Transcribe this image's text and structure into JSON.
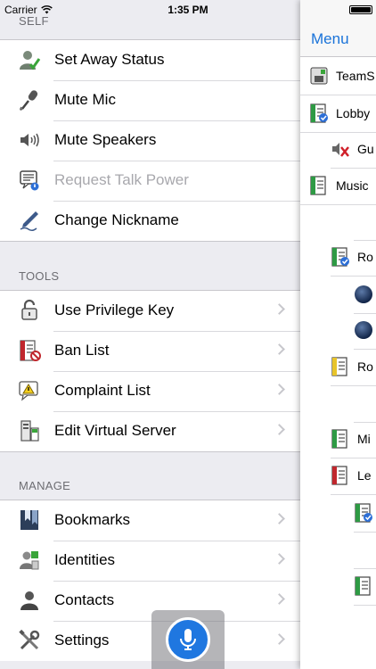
{
  "status_bar": {
    "carrier": "Carrier",
    "time": "1:35 PM",
    "battery_level": 1.0
  },
  "sections": [
    {
      "header": "SELF",
      "items": [
        {
          "label": "Set Away Status",
          "icon": "away-status-icon",
          "disabled": false,
          "chevron": false
        },
        {
          "label": "Mute Mic",
          "icon": "microphone-icon",
          "disabled": false,
          "chevron": false
        },
        {
          "label": "Mute Speakers",
          "icon": "speaker-icon",
          "disabled": false,
          "chevron": false
        },
        {
          "label": "Request Talk Power",
          "icon": "talk-power-icon",
          "disabled": true,
          "chevron": false
        },
        {
          "label": "Change Nickname",
          "icon": "pen-icon",
          "disabled": false,
          "chevron": false
        }
      ]
    },
    {
      "header": "TOOLS",
      "items": [
        {
          "label": "Use Privilege Key",
          "icon": "padlock-icon",
          "disabled": false,
          "chevron": true
        },
        {
          "label": "Ban List",
          "icon": "ban-list-icon",
          "disabled": false,
          "chevron": true
        },
        {
          "label": "Complaint List",
          "icon": "warning-icon",
          "disabled": false,
          "chevron": true
        },
        {
          "label": "Edit Virtual Server",
          "icon": "server-icon",
          "disabled": false,
          "chevron": true
        }
      ]
    },
    {
      "header": "MANAGE",
      "items": [
        {
          "label": "Bookmarks",
          "icon": "bookmarks-icon",
          "disabled": false,
          "chevron": true
        },
        {
          "label": "Identities",
          "icon": "identities-icon",
          "disabled": false,
          "chevron": true
        },
        {
          "label": "Contacts",
          "icon": "contacts-icon",
          "disabled": false,
          "chevron": true
        },
        {
          "label": "Settings",
          "icon": "tools-icon",
          "disabled": false,
          "chevron": true
        }
      ]
    }
  ],
  "channel_panel": {
    "nav_button": "Menu",
    "tree": [
      {
        "label": "TeamS",
        "icon": "server-root-icon"
      },
      {
        "label": "Lobby",
        "icon": "channel-green-check-icon"
      },
      {
        "label": "Gu",
        "icon": "muted-speaker-icon"
      },
      {
        "label": "Music",
        "icon": "channel-green-icon"
      },
      {
        "label": "",
        "icon": ""
      },
      {
        "label": "Ro",
        "icon": "channel-green-check-icon"
      },
      {
        "label": "",
        "icon": "user-dot-icon"
      },
      {
        "label": "",
        "icon": "user-dot-icon"
      },
      {
        "label": "Ro",
        "icon": "channel-yellow-icon"
      },
      {
        "label": "",
        "icon": ""
      },
      {
        "label": "Mi",
        "icon": "channel-green-icon"
      },
      {
        "label": "Le",
        "icon": "channel-red-icon"
      },
      {
        "label": "",
        "icon": "channel-green-check-icon"
      },
      {
        "label": "",
        "icon": ""
      },
      {
        "label": "",
        "icon": "channel-green-icon"
      }
    ]
  },
  "colors": {
    "accent": "#1a73d9",
    "mic_button": "#1f77e0",
    "disabled_text": "#a8a8ad",
    "section_header_text": "#6d6d72"
  }
}
